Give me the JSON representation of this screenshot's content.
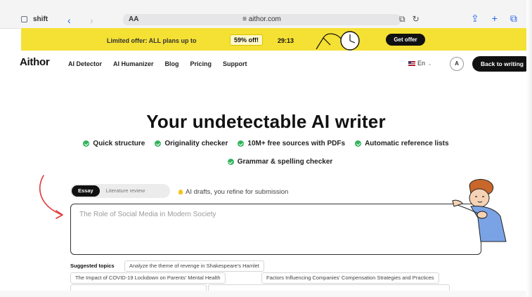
{
  "browser": {
    "left_label": "shift",
    "aa_label": "AA",
    "url": "aithor.com"
  },
  "promo": {
    "text": "Limited offer: ALL plans up to",
    "discount": "59% off!",
    "timer": "29:13",
    "cta": "Get offer",
    "color": "#f5e034"
  },
  "nav": {
    "logo": "Aithor",
    "links": [
      "AI Detector",
      "AI Humanizer",
      "Blog",
      "Pricing",
      "Support"
    ],
    "language": "En",
    "avatar_initial": "A",
    "back_button": "Back to writing"
  },
  "hero": {
    "title": "Your undetectable AI writer",
    "features_row1": [
      "Quick structure",
      "Originality checker",
      "10M+ free sources with PDFs",
      "Automatic reference lists"
    ],
    "features_row2": [
      "Grammar & spelling checker"
    ],
    "check_color": "#31b35b"
  },
  "editor": {
    "tabs": [
      "Essay",
      "Literature review"
    ],
    "active_tab": "Essay",
    "hint": "AI drafts, you refine for submission",
    "placeholder": "The Role of Social Media in Modern Society"
  },
  "suggestions": {
    "label": "Suggested topics",
    "topics": [
      "Analyze the theme of revenge in Shakespeare's Hamlet",
      "The Impact of COVID-19 Lockdown on Parents' Mental Health",
      "Factors Influencing Companies' Compensation Strategies and Practices"
    ]
  },
  "icons": {
    "promo_art": "clock-illustration",
    "arrow": "red-curved-arrow",
    "character": "person-peeking-illustration"
  },
  "accent_colors": {
    "arrow": "#e03a3a",
    "button_dark": "#111111"
  }
}
